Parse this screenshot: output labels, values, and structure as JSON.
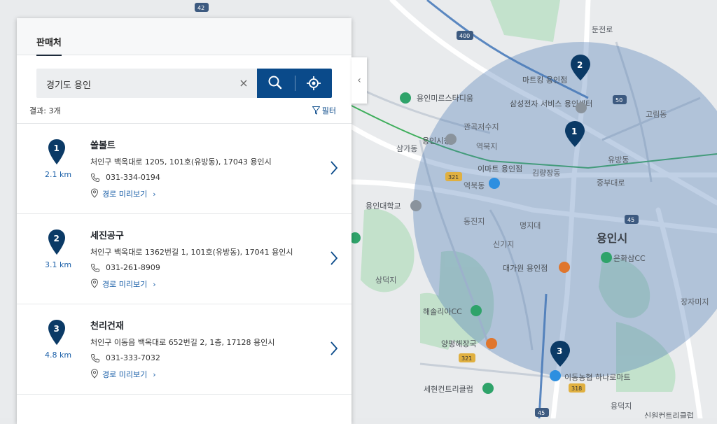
{
  "panel": {
    "tab_label": "판매처",
    "search": {
      "value": "경기도 용인",
      "clear_symbol": "×"
    },
    "collapse_symbol": "‹",
    "results": {
      "count_label": "결과: 3개",
      "filter_label": "필터"
    },
    "items": [
      {
        "index": "1",
        "distance": "2.1 km",
        "name": "쏠볼트",
        "address": "처인구 백옥대로 1205, 101호(유방동), 17043 용인시",
        "phone": "031-334-0194",
        "route_label": "경로 미리보기",
        "route_chevron": "›"
      },
      {
        "index": "2",
        "distance": "3.1 km",
        "name": "세진공구",
        "address": "처인구 백옥대로 1362번길 1, 101호(유방동), 17041 용인시",
        "phone": "031-261-8909",
        "route_label": "경로 미리보기",
        "route_chevron": "›"
      },
      {
        "index": "3",
        "distance": "4.8 km",
        "name": "천리건재",
        "address": "처인구 이동읍 백옥대로 652번길 2, 1층, 17128 용인시",
        "phone": "031-333-7032",
        "route_label": "경로 미리보기",
        "route_chevron": "›"
      }
    ]
  },
  "map": {
    "city_label": "용인시",
    "markers": [
      "1",
      "2",
      "3"
    ],
    "road_shields": [
      "42",
      "400",
      "50",
      "321",
      "45",
      "321",
      "318",
      "45"
    ],
    "places": [
      "용인미르스타디움",
      "용인시청",
      "이마트 용인점",
      "용인대학교",
      "마트킹 용인점",
      "삼성전자 서비스 용인센터",
      "대가원 용인점",
      "은화삼CC",
      "해솔리아CC",
      "양평해장국",
      "이동농협 하나로마트",
      "세현컨트리클럽",
      "역북동",
      "김량장동",
      "중부대로",
      "고림동",
      "명지대",
      "삼가동",
      "관곡저수지",
      "역북지",
      "동진지",
      "신기지",
      "상덕지",
      "둔전로",
      "유방동",
      "장자미지",
      "용덕지",
      "신원컨트리클럽"
    ]
  },
  "colors": {
    "accent": "#0a4a8a",
    "marker": "#0b3a66",
    "radius_fill": "#4a78b5"
  }
}
